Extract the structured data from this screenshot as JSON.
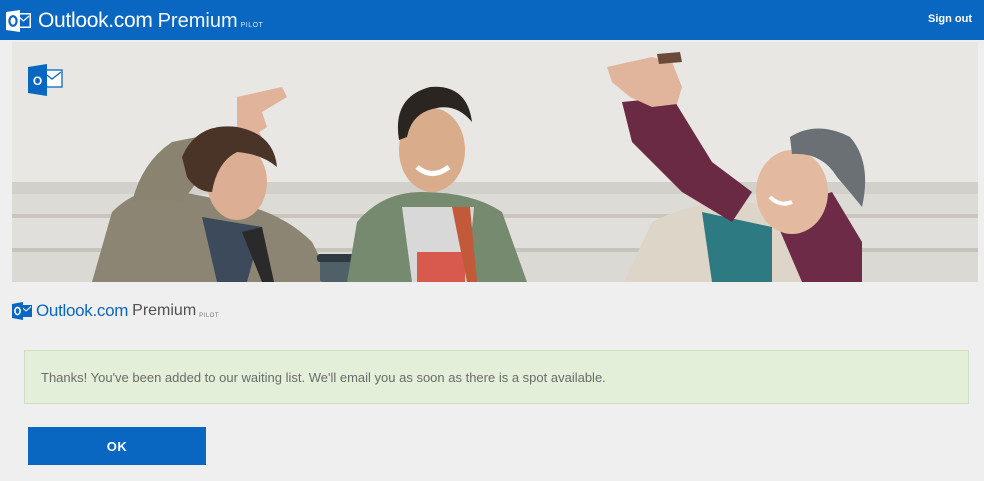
{
  "app": {
    "brand_name": "Outlook.com",
    "brand_premium": "Premium",
    "brand_pilot": "PILOT",
    "logo_letter": "O"
  },
  "header": {
    "sign_out_label": "Sign out"
  },
  "content": {
    "brand_name": "Outlook.com",
    "brand_premium": "Premium",
    "brand_pilot": "PILOT",
    "message": "Thanks! You've been added to our waiting list. We'll email you as soon as there is a spot available."
  },
  "actions": {
    "ok_label": "OK"
  },
  "colors": {
    "brand_blue": "#0a67c1",
    "message_background": "#e3efd8",
    "page_background": "#efefef"
  },
  "icons": {
    "brand_logo": "outlook-logo-icon",
    "hero_badge": "outlook-logo-icon"
  }
}
